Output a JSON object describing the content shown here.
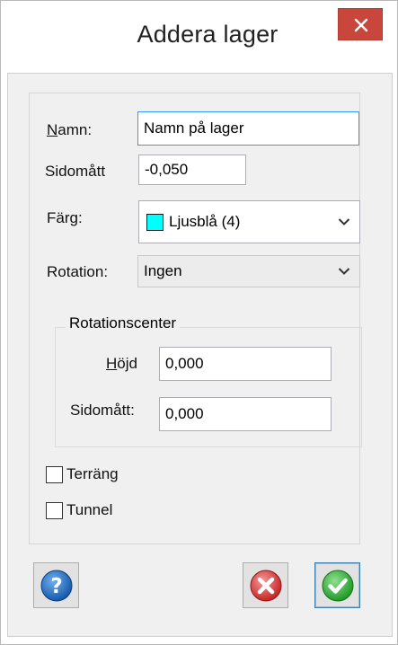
{
  "window": {
    "title": "Addera lager",
    "close_label": "×"
  },
  "form": {
    "name": {
      "label_underlined": "N",
      "label_rest": "amn:",
      "value": "Namn på lager"
    },
    "sidomatt": {
      "label": "Sidomått",
      "value": "-0,050"
    },
    "color": {
      "label": "Färg:",
      "value": "Ljusblå (4)",
      "swatch_color": "#00ffff"
    },
    "rotation": {
      "label": "Rotation:",
      "value": "Ingen"
    }
  },
  "rotation_center": {
    "title": "Rotationscenter",
    "hojd": {
      "label_underlined": "H",
      "label_rest": "öjd",
      "value": "0,000"
    },
    "sidomatt": {
      "label": "Sidomått:",
      "value": "0,000"
    }
  },
  "checkboxes": {
    "terrang": {
      "label": "Terräng",
      "checked": false
    },
    "tunnel": {
      "label": "Tunnel",
      "checked": false
    }
  },
  "buttons": {
    "help": {
      "icon": "help-icon",
      "color": "#1f6fc5"
    },
    "cancel": {
      "icon": "cancel-icon",
      "color": "#d23a3a"
    },
    "ok": {
      "icon": "ok-icon",
      "color": "#2faa2f"
    }
  }
}
